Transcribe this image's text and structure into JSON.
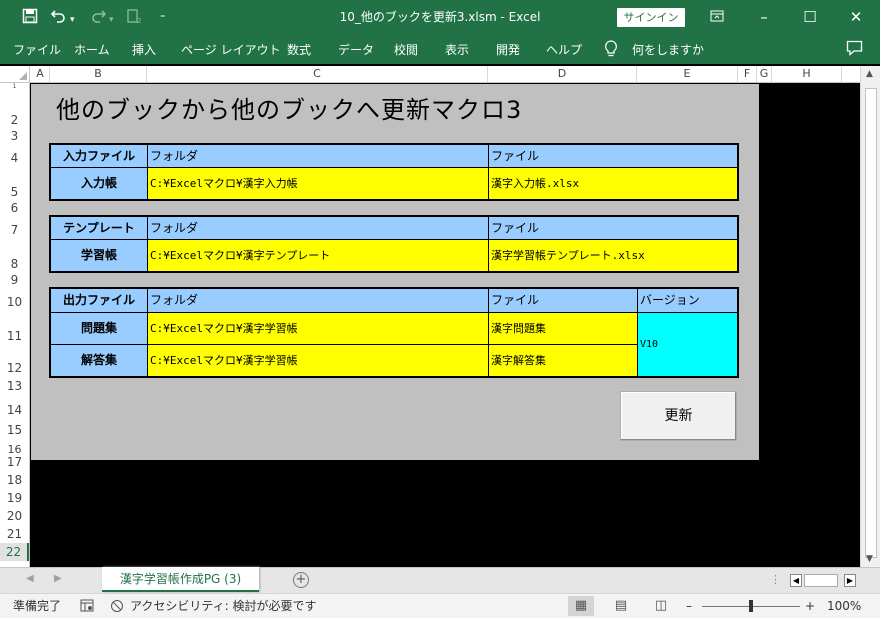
{
  "titlebar": {
    "title": "10_他のブックを更新3.xlsm  -  Excel",
    "signin": "サインイン",
    "icons": [
      "save-icon",
      "undo-icon",
      "redo-icon",
      "custom-qa-icon",
      "customize-qa-icon"
    ],
    "window_buttons": [
      "ribbon-display-icon",
      "minimize-icon",
      "maximize-icon",
      "close-icon"
    ]
  },
  "ribbon": {
    "tabs": [
      "ファイル",
      "ホーム",
      "挿入",
      "ページ レイアウト",
      "数式",
      "データ",
      "校閲",
      "表示",
      "開発",
      "ヘルプ"
    ],
    "tellme": "何をしますか"
  },
  "columns": [
    "A",
    "B",
    "C",
    "D",
    "E",
    "F",
    "G",
    "H"
  ],
  "rows": [
    "1",
    "2",
    "3",
    "4",
    "5",
    "6",
    "7",
    "8",
    "9",
    "10",
    "11",
    "12",
    "13",
    "14",
    "15",
    "16",
    "17",
    "18",
    "19",
    "20",
    "21",
    "22"
  ],
  "sheet": {
    "title": "他のブックから他のブックへ更新マクロ3",
    "input": {
      "label": "入力ファイル",
      "folder_header": "フォルダ",
      "file_header": "ファイル",
      "row_label": "入力帳",
      "folder": "C:¥Excelマクロ¥漢字入力帳",
      "file": "漢字入力帳.xlsx"
    },
    "template": {
      "label": "テンプレート",
      "folder_header": "フォルダ",
      "file_header": "ファイル",
      "row_label": "学習帳",
      "folder": "C:¥Excelマクロ¥漢字テンプレート",
      "file": "漢字学習帳テンプレート.xlsx"
    },
    "output": {
      "label": "出力ファイル",
      "folder_header": "フォルダ",
      "file_header": "ファイル",
      "version_header": "バージョン",
      "row1_label": "問題集",
      "row1_folder": "C:¥Excelマクロ¥漢字学習帳",
      "row1_file": "漢字問題集",
      "row2_label": "解答集",
      "row2_folder": "C:¥Excelマクロ¥漢字学習帳",
      "row2_file": "漢字解答集",
      "version": "V10"
    },
    "update_button": "更新"
  },
  "sheet_tabs": {
    "active": "漢字学習帳作成PG (3)"
  },
  "statusbar": {
    "ready": "準備完了",
    "accessibility": "アクセシビリティ: 検討が必要です",
    "zoom": "100%"
  },
  "colors": {
    "excel_green": "#217346",
    "header_blue": "#99ccff",
    "value_yellow": "#ffff00",
    "version_cyan": "#00ffff",
    "panel_gray": "#c0c0c0"
  }
}
